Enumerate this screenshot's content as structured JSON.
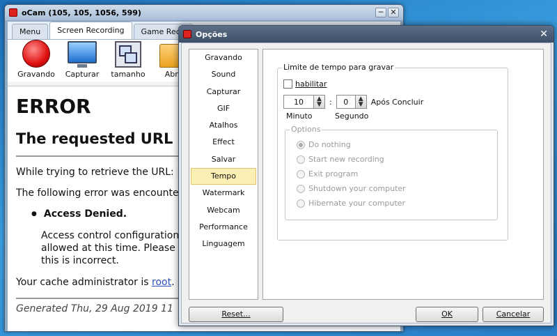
{
  "ocam": {
    "title": "oCam (105, 105, 1056, 599)",
    "controls": {
      "minimize": "─",
      "close": "✕"
    },
    "tabs": [
      {
        "label": "Menu"
      },
      {
        "label": "Screen Recording"
      },
      {
        "label": "Game Reco"
      }
    ],
    "toolbar": [
      {
        "label": "Gravando",
        "icon": "record-icon"
      },
      {
        "label": "Capturar",
        "icon": "monitor-icon"
      },
      {
        "label": "tamanho",
        "icon": "resize-icon"
      },
      {
        "label": "Abrir",
        "icon": "folder-icon"
      }
    ],
    "page": {
      "h1": "ERROR",
      "h2": "The requested URL",
      "p1": "While trying to retrieve the URL:",
      "p2": "The following error was encounte",
      "li": "Access Denied.",
      "detail1": "Access control configuration",
      "detail2": "allowed at this time. Please",
      "detail3": "this is incorrect.",
      "admin_prefix": "Your cache administrator is ",
      "admin_link": "root",
      "admin_suffix": ".",
      "footer": "Generated Thu, 29 Aug 2019 11"
    }
  },
  "dialog": {
    "title": "Opções",
    "close": "✕",
    "nav": [
      "Gravando",
      "Sound",
      "Capturar",
      "GIF",
      "Atalhos",
      "Effect",
      "Salvar",
      "Tempo",
      "Watermark",
      "Webcam",
      "Performance",
      "Linguagem"
    ],
    "selected_nav": "Tempo",
    "group_title": "Limite de tempo para gravar",
    "enable_label": "habilitar",
    "minutes_value": "10",
    "seconds_value": "0",
    "colon": ":",
    "after_label": "Após Concluir",
    "minutes_caption": "Minuto",
    "seconds_caption": "Segundo",
    "options_title": "Options",
    "options": [
      "Do nothing",
      "Start new recording",
      "Exit program",
      "Shutdown your computer",
      "Hibernate your computer"
    ],
    "reset_label": "Reset...",
    "ok_label": "OK",
    "cancel_label": "Cancelar"
  }
}
